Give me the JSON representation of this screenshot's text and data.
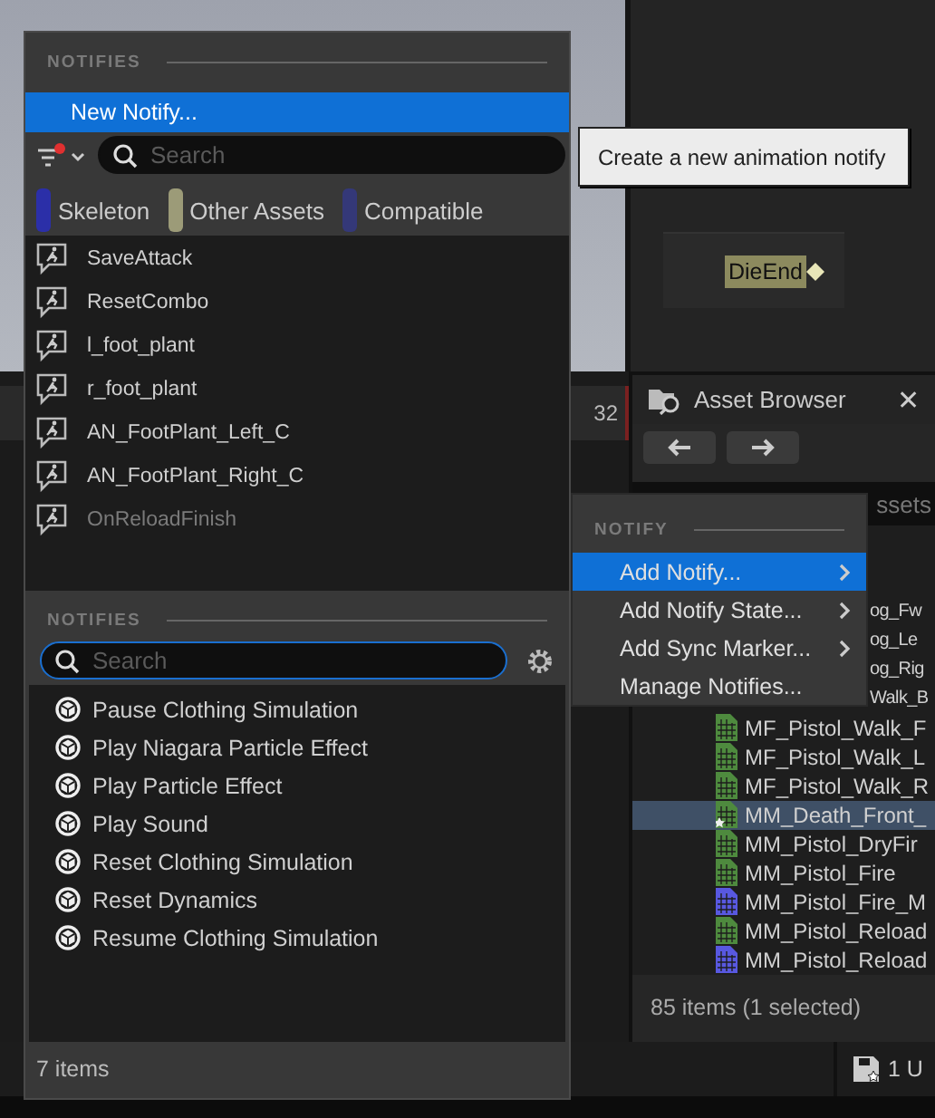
{
  "notifies_popup": {
    "header": "NOTIFIES",
    "new_notify": {
      "label": "New Notify...",
      "selected": true
    },
    "search": {
      "placeholder": "Search"
    },
    "filters": [
      {
        "label": "Skeleton",
        "color": "#2b2fa8"
      },
      {
        "label": "Other Assets",
        "color": "#9c9b78"
      },
      {
        "label": "Compatible",
        "color": "#343878"
      }
    ],
    "items": [
      {
        "label": "SaveAttack",
        "disabled": false
      },
      {
        "label": "ResetCombo",
        "disabled": false
      },
      {
        "label": "l_foot_plant",
        "disabled": false
      },
      {
        "label": "r_foot_plant",
        "disabled": false
      },
      {
        "label": "AN_FootPlant_Left_C",
        "disabled": false
      },
      {
        "label": "AN_FootPlant_Right_C",
        "disabled": false
      },
      {
        "label": "OnReloadFinish",
        "disabled": true
      }
    ]
  },
  "notify_classes": {
    "header": "NOTIFIES",
    "search": {
      "placeholder": "Search",
      "focused": true
    },
    "items": [
      "Pause Clothing Simulation",
      "Play Niagara Particle Effect",
      "Play Particle Effect",
      "Play Sound",
      "Reset Clothing Simulation",
      "Reset Dynamics",
      "Resume Clothing Simulation"
    ],
    "footer": "7 items"
  },
  "tooltip": "Create a new animation notify",
  "track_marker": "DieEnd",
  "timeline": {
    "frame_label": "32"
  },
  "context_menu": {
    "header": "NOTIFY",
    "items": [
      {
        "label": "Add Notify...",
        "submenu": true,
        "selected": true
      },
      {
        "label": "Add Notify State...",
        "submenu": true,
        "selected": false
      },
      {
        "label": "Add Sync Marker...",
        "submenu": true,
        "selected": false
      },
      {
        "label": "Manage Notifies...",
        "submenu": false,
        "selected": false
      }
    ]
  },
  "asset_browser": {
    "title": "Asset Browser",
    "close": "✕",
    "search": {
      "placeholder": "ssets"
    },
    "rows": [
      {
        "label": "og_Fw",
        "kind": "covered",
        "selected": false
      },
      {
        "label": "og_Le",
        "kind": "covered",
        "selected": false
      },
      {
        "label": "og_Rig",
        "kind": "covered",
        "selected": false
      },
      {
        "label": "Walk_B",
        "kind": "covered",
        "selected": false
      },
      {
        "label": "MF_Pistol_Walk_F",
        "kind": "full",
        "color": "#4e8a3e",
        "selected": false
      },
      {
        "label": "MF_Pistol_Walk_L",
        "kind": "full",
        "color": "#4e8a3e",
        "selected": false
      },
      {
        "label": "MF_Pistol_Walk_R",
        "kind": "full",
        "color": "#4e8a3e",
        "selected": false
      },
      {
        "label": "MM_Death_Front_",
        "kind": "full",
        "color": "#4e8a3e",
        "selected": true
      },
      {
        "label": "MM_Pistol_DryFir",
        "kind": "full",
        "color": "#4e8a3e",
        "selected": false
      },
      {
        "label": "MM_Pistol_Fire",
        "kind": "full",
        "color": "#4e8a3e",
        "selected": false
      },
      {
        "label": "MM_Pistol_Fire_M",
        "kind": "full",
        "color": "#5858e0",
        "selected": false
      },
      {
        "label": "MM_Pistol_Reload",
        "kind": "full",
        "color": "#4e8a3e",
        "selected": false
      },
      {
        "label": "MM_Pistol_Reload",
        "kind": "full",
        "color": "#5858e0",
        "selected": false
      }
    ],
    "footer": "85 items (1 selected)"
  },
  "status_bar": {
    "unsaved": "1 U"
  }
}
